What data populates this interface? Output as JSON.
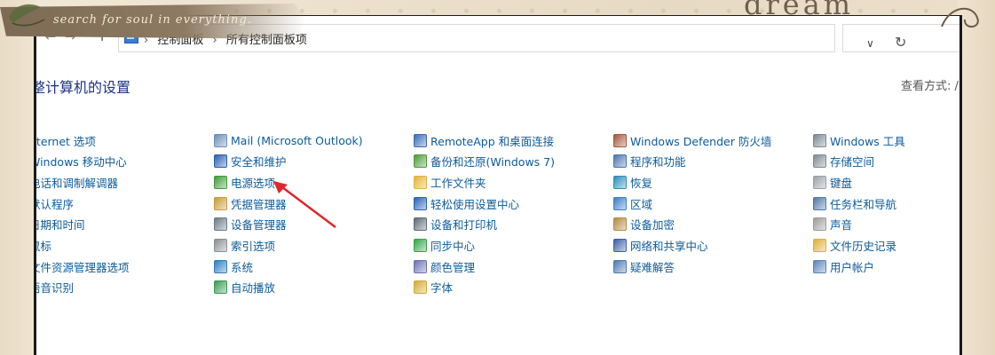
{
  "decor": {
    "banner_text": "search for soul in everything.",
    "corner_text": "dream"
  },
  "addressbar": {
    "back": "←",
    "forward": "→",
    "recent": "˅",
    "up": "↑",
    "breadcrumbs": [
      "控制面板",
      "所有控制面板项"
    ],
    "separator": "›",
    "dropdown": "∨",
    "refresh": "↻"
  },
  "page": {
    "title": "整计算机的设置",
    "view_by": "查看方式:  /"
  },
  "columns": [
    {
      "items": [
        {
          "label": "nternet 选项",
          "icon": "none"
        },
        {
          "label": "Windows 移动中心",
          "icon": "none"
        },
        {
          "label": "电话和调制解调器",
          "icon": "none"
        },
        {
          "label": "默认程序",
          "icon": "none"
        },
        {
          "label": "日期和时间",
          "icon": "none"
        },
        {
          "label": "鼠标",
          "icon": "none"
        },
        {
          "label": "文件资源管理器选项",
          "icon": "none"
        },
        {
          "label": "语音识别",
          "icon": "none"
        }
      ]
    },
    {
      "items": [
        {
          "label": "Mail (Microsoft Outlook)",
          "icon": "mail-icon",
          "color": "#6c8fb8"
        },
        {
          "label": "安全和维护",
          "icon": "flag-icon",
          "color": "#2b5fb0"
        },
        {
          "label": "电源选项",
          "icon": "power-icon",
          "color": "#3f9b3a"
        },
        {
          "label": "凭据管理器",
          "icon": "credential-icon",
          "color": "#c79a3a"
        },
        {
          "label": "设备管理器",
          "icon": "device-manager-icon",
          "color": "#6d7b88"
        },
        {
          "label": "索引选项",
          "icon": "index-icon",
          "color": "#8a8f96"
        },
        {
          "label": "系统",
          "icon": "system-icon",
          "color": "#2f7dc1"
        },
        {
          "label": "自动播放",
          "icon": "autoplay-icon",
          "color": "#3c9a55"
        }
      ]
    },
    {
      "items": [
        {
          "label": "RemoteApp 和桌面连接",
          "icon": "remoteapp-icon",
          "color": "#3a6cb5"
        },
        {
          "label": "备份和还原(Windows 7)",
          "icon": "backup-icon",
          "color": "#4f9a3d"
        },
        {
          "label": "工作文件夹",
          "icon": "work-folders-icon",
          "color": "#e3b33a"
        },
        {
          "label": "轻松使用设置中心",
          "icon": "ease-of-access-icon",
          "color": "#2a62b6"
        },
        {
          "label": "设备和打印机",
          "icon": "printer-icon",
          "color": "#5e6b78"
        },
        {
          "label": "同步中心",
          "icon": "sync-icon",
          "color": "#37a44a"
        },
        {
          "label": "颜色管理",
          "icon": "color-management-icon",
          "color": "#6b74b0"
        },
        {
          "label": "字体",
          "icon": "font-icon",
          "color": "#d4a93a"
        }
      ]
    },
    {
      "items": [
        {
          "label": "Windows Defender 防火墙",
          "icon": "firewall-icon",
          "color": "#a5573a"
        },
        {
          "label": "程序和功能",
          "icon": "programs-icon",
          "color": "#4a76b0"
        },
        {
          "label": "恢复",
          "icon": "recovery-icon",
          "color": "#2e8dbd"
        },
        {
          "label": "区域",
          "icon": "region-icon",
          "color": "#3b7fc6"
        },
        {
          "label": "设备加密",
          "icon": "encryption-icon",
          "color": "#b38a3e"
        },
        {
          "label": "网络和共享中心",
          "icon": "network-icon",
          "color": "#3d5fa8"
        },
        {
          "label": "疑难解答",
          "icon": "troubleshoot-icon",
          "color": "#4d7bb3"
        }
      ]
    },
    {
      "items": [
        {
          "label": "Windows 工具",
          "icon": "windows-tools-icon",
          "color": "#7b8894"
        },
        {
          "label": "存储空间",
          "icon": "storage-icon",
          "color": "#808a93"
        },
        {
          "label": "键盘",
          "icon": "keyboard-icon",
          "color": "#9aa1a8"
        },
        {
          "label": "任务栏和导航",
          "icon": "taskbar-icon",
          "color": "#4f78a8"
        },
        {
          "label": "声音",
          "icon": "sound-icon",
          "color": "#9b9b9b"
        },
        {
          "label": "文件历史记录",
          "icon": "file-history-icon",
          "color": "#dcb03a"
        },
        {
          "label": "用户帐户",
          "icon": "user-accounts-icon",
          "color": "#5a86bb"
        }
      ]
    }
  ],
  "colors": {
    "link": "#0c5b9b",
    "title": "#1e3287",
    "annotation_arrow": "#e0262a"
  }
}
